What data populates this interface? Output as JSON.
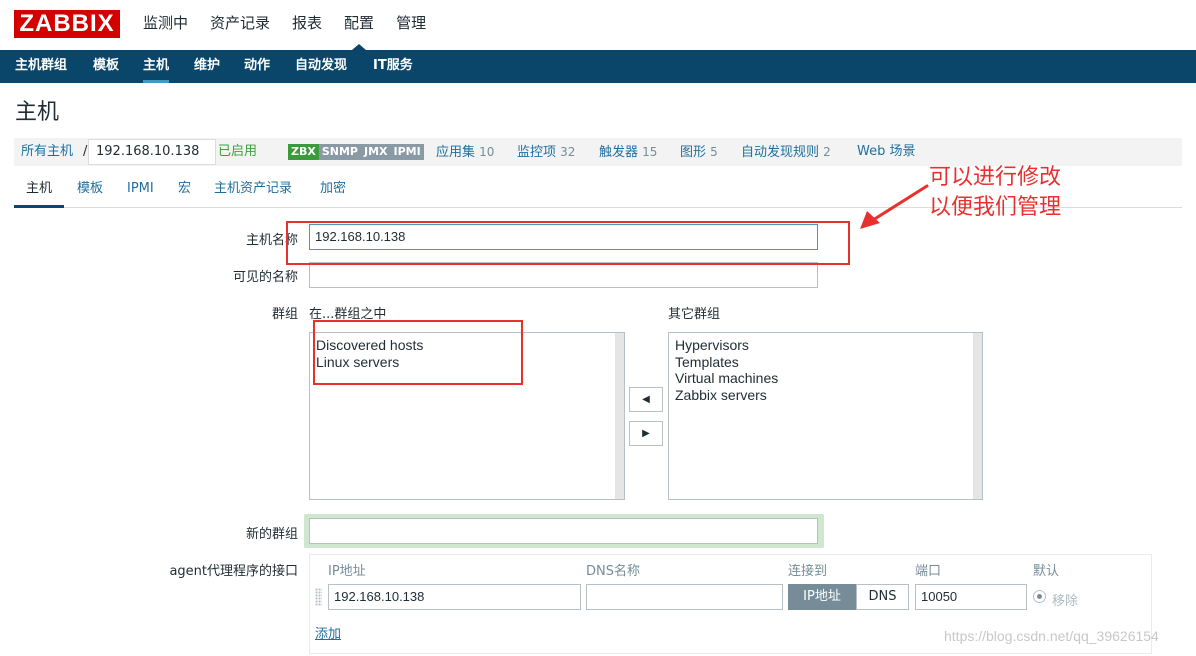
{
  "logo": "ZABBIX",
  "top_menu": [
    "监测中",
    "资产记录",
    "报表",
    "配置",
    "管理"
  ],
  "sub_menu": [
    "主机群组",
    "模板",
    "主机",
    "维护",
    "动作",
    "自动发现",
    "IT服务"
  ],
  "page_title": "主机",
  "breadcrumb": {
    "all_hosts": "所有主机",
    "separator": "/",
    "host": "192.168.10.138",
    "enabled": "已启用",
    "status": [
      "ZBX",
      "SNMP",
      "JMX",
      "IPMI"
    ],
    "links": [
      {
        "label": "应用集",
        "count": "10"
      },
      {
        "label": "监控项",
        "count": "32"
      },
      {
        "label": "触发器",
        "count": "15"
      },
      {
        "label": "图形",
        "count": "5"
      },
      {
        "label": "自动发现规则",
        "count": "2"
      },
      {
        "label": "Web 场景",
        "count": ""
      }
    ]
  },
  "form_tabs": [
    "主机",
    "模板",
    "IPMI",
    "宏",
    "主机资产记录",
    "加密"
  ],
  "form": {
    "hostname_label": "主机名称",
    "hostname_value": "192.168.10.138",
    "visible_name_label": "可见的名称",
    "visible_name_value": "",
    "groups_label": "群组",
    "in_groups_label": "在...群组之中",
    "other_groups_label": "其它群组",
    "in_groups": [
      "Discovered hosts",
      "Linux servers"
    ],
    "other_groups": [
      "Hypervisors",
      "Templates",
      "Virtual machines",
      "Zabbix servers"
    ],
    "move_left": "◀",
    "move_right": "▶",
    "new_group_label": "新的群组",
    "new_group_value": "",
    "agent_label": "agent代理程序的接口",
    "iface_headers": {
      "ip": "IP地址",
      "dns": "DNS名称",
      "connect": "连接到",
      "port": "端口",
      "default": "默认"
    },
    "iface_ip": "192.168.10.138",
    "iface_dns": "",
    "connect_ip": "IP地址",
    "connect_dns": "DNS",
    "iface_port": "10050",
    "remove": "移除",
    "add": "添加"
  },
  "annotation": [
    "可以进行修改",
    "以便我们管理"
  ],
  "watermark": "https://blog.csdn.net/qq_39626154",
  "colors": {
    "brand": "#d40000",
    "nav": "#0a466a",
    "link": "#1f6f9e",
    "annotation": "#e8312f"
  }
}
